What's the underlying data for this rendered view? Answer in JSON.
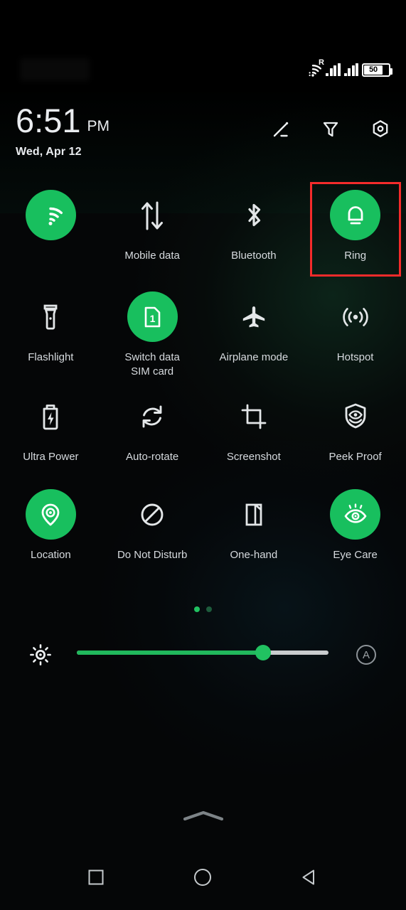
{
  "statusbar": {
    "wifi_icon": "wifi-icon",
    "roaming_label": "R",
    "signal1_icon": "signal-bars-sim1-icon",
    "signal2_icon": "signal-bars-sim2-icon",
    "battery_icon": "battery-icon",
    "battery_level": "50"
  },
  "header": {
    "time": "6:51",
    "ampm": "PM",
    "date": "Wed, Apr 12",
    "actions": [
      {
        "name": "edit-tiles-icon",
        "label": "Edit"
      },
      {
        "name": "filter-icon",
        "label": "Filter"
      },
      {
        "name": "settings-gear-icon",
        "label": "Settings"
      }
    ]
  },
  "tiles": {
    "rows": [
      [
        {
          "label": "",
          "icon": "wifi-icon",
          "state": "on",
          "highlighted": false
        },
        {
          "label": "Mobile data",
          "icon": "mobile-data-icon",
          "state": "off",
          "highlighted": false
        },
        {
          "label": "Bluetooth",
          "icon": "bluetooth-icon",
          "state": "off",
          "highlighted": false
        },
        {
          "label": "Ring",
          "icon": "ring-bell-icon",
          "state": "on",
          "highlighted": true
        }
      ],
      [
        {
          "label": "Flashlight",
          "icon": "flashlight-icon",
          "state": "off",
          "highlighted": false
        },
        {
          "label": "Switch data SIM card",
          "icon": "sim-card-icon",
          "state": "on",
          "highlighted": false
        },
        {
          "label": "Airplane mode",
          "icon": "airplane-icon",
          "state": "off",
          "highlighted": false
        },
        {
          "label": "Hotspot",
          "icon": "hotspot-icon",
          "state": "off",
          "highlighted": false
        }
      ],
      [
        {
          "label": "Ultra Power",
          "icon": "battery-bolt-icon",
          "state": "off",
          "highlighted": false
        },
        {
          "label": "Auto-rotate",
          "icon": "auto-rotate-icon",
          "state": "off",
          "highlighted": false
        },
        {
          "label": "Screenshot",
          "icon": "screenshot-crop-icon",
          "state": "off",
          "highlighted": false
        },
        {
          "label": "Peek Proof",
          "icon": "shield-eye-icon",
          "state": "off",
          "highlighted": false
        }
      ],
      [
        {
          "label": "Location",
          "icon": "location-pin-icon",
          "state": "on",
          "highlighted": false
        },
        {
          "label": "Do Not Disturb",
          "icon": "do-not-disturb-icon",
          "state": "off",
          "highlighted": false
        },
        {
          "label": "One-hand",
          "icon": "one-hand-icon",
          "state": "off",
          "highlighted": false
        },
        {
          "label": "Eye Care",
          "icon": "eye-care-icon",
          "state": "on",
          "highlighted": false
        }
      ]
    ]
  },
  "pager": {
    "total": 2,
    "active_index": 0
  },
  "brightness": {
    "sun_icon": "brightness-sun-icon",
    "value_percent": 74,
    "auto_label": "A",
    "auto_icon": "auto-brightness-icon"
  },
  "handle": {
    "icon": "collapse-chevron-handle-icon"
  },
  "navbar": {
    "buttons": [
      {
        "name": "recents-button",
        "icon": "square-icon"
      },
      {
        "name": "home-button",
        "icon": "circle-icon"
      },
      {
        "name": "back-button",
        "icon": "triangle-left-icon"
      }
    ]
  },
  "colors": {
    "accent_green": "#18bf5e",
    "highlight_red": "#f42b2b",
    "text_primary": "#e9ecef",
    "text_secondary": "#d6dade",
    "background": "#050607"
  }
}
